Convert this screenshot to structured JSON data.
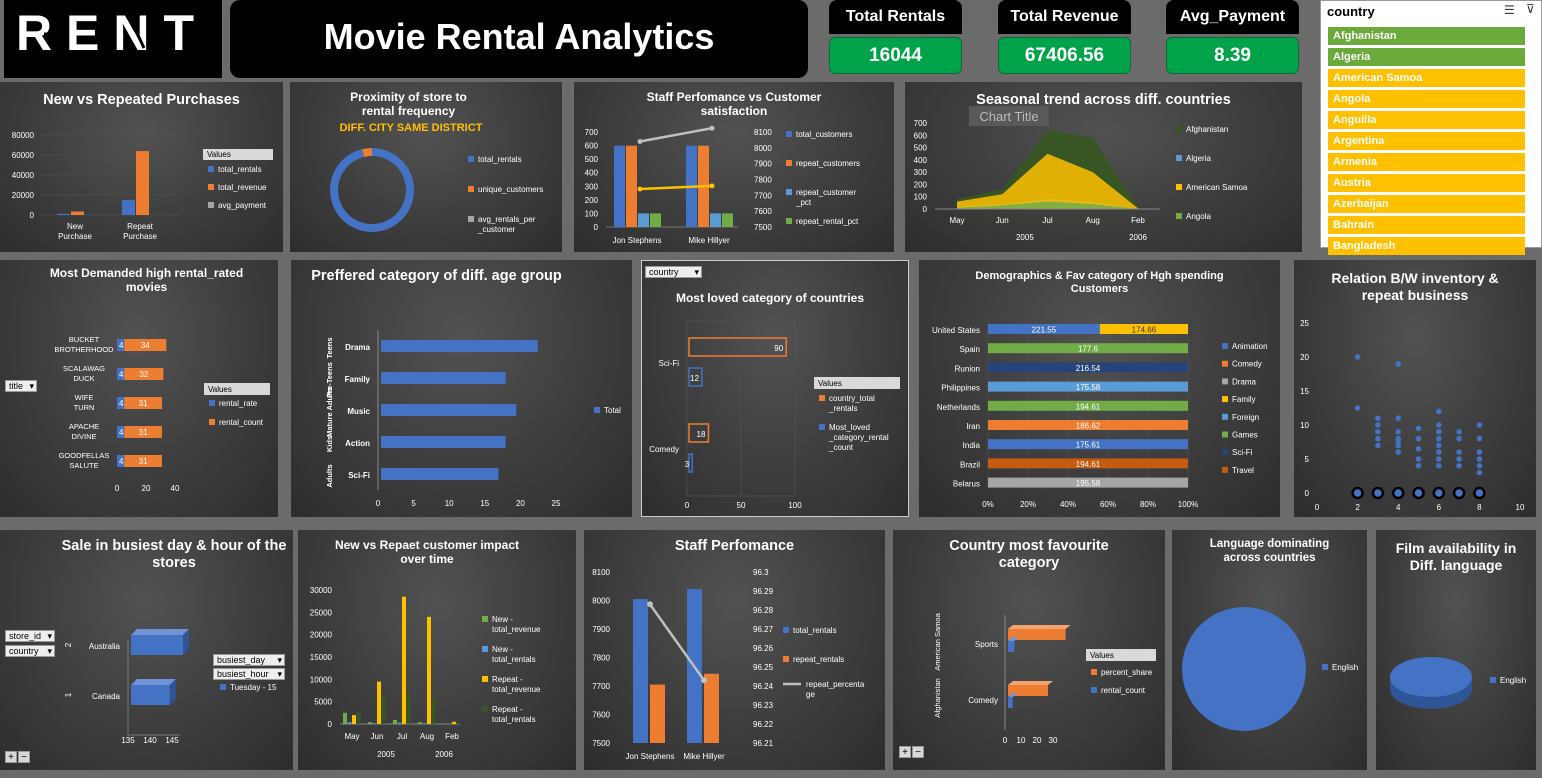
{
  "logo": "RENT",
  "title": "Movie Rental Analytics",
  "kpis": [
    {
      "label": "Total Rentals",
      "value": "16044"
    },
    {
      "label": "Total Revenue",
      "value": "67406.56"
    },
    {
      "label": "Avg_Payment",
      "value": "8.39"
    }
  ],
  "slicer": {
    "title": "country",
    "items": [
      "Afghanistan",
      "Algeria",
      "American Samoa",
      "Angola",
      "Anguilla",
      "Argentina",
      "Armenia",
      "Austria",
      "Azerbaijan",
      "Bahrain",
      "Bangladesh"
    ],
    "selected_color": "#6aaa3a",
    "item_color": "#ffc000"
  },
  "colors": {
    "blue": "#4472c4",
    "orange": "#ed7d31",
    "gray": "#a5a5a5",
    "yellow": "#ffc000",
    "green": "#70ad47",
    "lightblue": "#5b9bd5",
    "navy": "#264478",
    "darkorange": "#c55a11",
    "darkgreen": "#375623",
    "kpi_green": "#00a24a"
  },
  "chart_data": [
    {
      "id": "c1",
      "type": "bar",
      "title": "New vs Repeated Purchases",
      "categories": [
        "New Purchase",
        "Repeat Purchase"
      ],
      "series": [
        {
          "name": "total_rentals",
          "values": [
            1200,
            14844
          ]
        },
        {
          "name": "total_revenue",
          "values": [
            3500,
            63906
          ]
        },
        {
          "name": "avg_payment",
          "values": [
            3,
            8
          ]
        }
      ],
      "ylim": [
        0,
        80000
      ],
      "yticks": [
        0,
        20000,
        40000,
        60000,
        80000
      ],
      "legend_title": "Values"
    },
    {
      "id": "c2",
      "type": "pie",
      "title": "Proximity of store to rental frequency",
      "subtitle": "DIFF. CITY SAME DISTRICT",
      "series": [
        {
          "name": "total_rentals",
          "value": 16044
        },
        {
          "name": "unique_customers",
          "value": 599
        },
        {
          "name": "avg_rentals_per_customer",
          "value": 27
        }
      ]
    },
    {
      "id": "c3",
      "type": "bar",
      "title": "Staff Perfomance vs Customer satisfaction",
      "categories": [
        "Jon Stephens",
        "Mike Hillyer"
      ],
      "series": [
        {
          "name": "total_customers",
          "values": [
            599,
            599
          ]
        },
        {
          "name": "repeat_customers",
          "values": [
            599,
            599
          ]
        },
        {
          "name": "repeat_customer_pct",
          "values": [
            100,
            100
          ]
        },
        {
          "name": "repeat_rental_pct",
          "values": [
            100,
            100
          ]
        }
      ],
      "line_series": [
        {
          "values": [
            8040,
            8124
          ]
        },
        {
          "values": [
            7740,
            7760
          ]
        }
      ],
      "ylim": [
        0,
        700
      ],
      "yticks": [
        0,
        100,
        200,
        300,
        400,
        500,
        600,
        700
      ],
      "y2lim": [
        7500,
        8100
      ],
      "y2ticks": [
        7500,
        7600,
        7700,
        7800,
        7900,
        8000,
        8100
      ]
    },
    {
      "id": "c4",
      "type": "area",
      "title": "Seasonal trend across diff. countries",
      "overlay_label": "Chart Title",
      "categories": [
        "May",
        "Jun",
        "Jul",
        "Aug",
        "Feb"
      ],
      "groups": [
        {
          "label": "2005",
          "span": 4
        },
        {
          "label": "2006",
          "span": 1
        }
      ],
      "series": [
        {
          "name": "Afghanistan",
          "values": [
            80,
            160,
            640,
            580,
            10
          ]
        },
        {
          "name": "Algeria",
          "values": [
            20,
            40,
            80,
            60,
            2
          ]
        },
        {
          "name": "American Samoa",
          "values": [
            60,
            120,
            450,
            300,
            5
          ]
        },
        {
          "name": "Angola",
          "values": [
            10,
            30,
            60,
            40,
            1
          ]
        }
      ],
      "ylim": [
        0,
        700
      ],
      "yticks": [
        0,
        100,
        200,
        300,
        400,
        500,
        600,
        700
      ]
    },
    {
      "id": "c5",
      "type": "bar",
      "orientation": "horizontal",
      "title": "Most Demanded high rental_rated movies",
      "filter_label": "title",
      "categories": [
        "BUCKET BROTHERHOOD",
        "SCALAWAG DUCK",
        "WIFE TURN",
        "APACHE DIVINE",
        "GOODFELLAS SALUTE"
      ],
      "series": [
        {
          "name": "rental_rate",
          "values": [
            4.99,
            4.99,
            4.99,
            4.99,
            4.99
          ]
        },
        {
          "name": "rental_count",
          "values": [
            34,
            32,
            31,
            31,
            31
          ]
        }
      ],
      "xlim": [
        0,
        40
      ],
      "xticks": [
        0,
        20,
        40
      ],
      "legend_title": "Values"
    },
    {
      "id": "c6",
      "type": "bar",
      "orientation": "horizontal",
      "title": "Preffered category of diff. age group",
      "categories": [
        "Drama",
        "Family",
        "Music",
        "Action",
        "Sci-Fi"
      ],
      "groups": [
        "Teens",
        "Pre-Teens",
        "Mature Adults",
        "Kids",
        "Adults"
      ],
      "series": [
        {
          "name": "Total",
          "values": [
            22,
            17.5,
            19,
            17.5,
            16.5
          ]
        }
      ],
      "xlim": [
        0,
        25
      ],
      "xticks": [
        0,
        5,
        10,
        15,
        20,
        25
      ]
    },
    {
      "id": "c7",
      "type": "bar",
      "orientation": "horizontal",
      "title": "Most loved category of countries",
      "filter_label": "country",
      "categories": [
        "Sci-Fi",
        "Comedy"
      ],
      "series": [
        {
          "name": "country_total_rentals",
          "values": [
            90,
            18
          ]
        },
        {
          "name": "Most_loved_category_rental_count",
          "values": [
            12,
            3
          ]
        }
      ],
      "xlim": [
        0,
        100
      ],
      "xticks": [
        0,
        50,
        100
      ],
      "legend_title": "Values"
    },
    {
      "id": "c8",
      "type": "bar",
      "orientation": "horizontal",
      "stacked": "percent",
      "title": "Demographics & Fav category of Hgh spending Customers",
      "categories": [
        "United States",
        "Spain",
        "Runion",
        "Philippines",
        "Netherlands",
        "Iran",
        "India",
        "Brazil",
        "Belarus"
      ],
      "bars": [
        {
          "segments": [
            {
              "series": "Animation",
              "value": 221.55
            },
            {
              "series": "Family",
              "value": 174.66
            }
          ]
        },
        {
          "segments": [
            {
              "series": "Games",
              "value": 177.6
            }
          ]
        },
        {
          "segments": [
            {
              "series": "Sci-Fi",
              "value": 216.54
            }
          ]
        },
        {
          "segments": [
            {
              "series": "Foreign",
              "value": 175.58
            }
          ]
        },
        {
          "segments": [
            {
              "series": "Games",
              "value": 194.61
            }
          ]
        },
        {
          "segments": [
            {
              "series": "Comedy",
              "value": 186.62
            }
          ]
        },
        {
          "segments": [
            {
              "series": "Animation",
              "value": 175.61
            }
          ]
        },
        {
          "segments": [
            {
              "series": "Travel",
              "value": 194.61
            }
          ]
        },
        {
          "segments": [
            {
              "series": "Drama",
              "value": 195.58
            }
          ]
        }
      ],
      "legend": [
        "Animation",
        "Comedy",
        "Drama",
        "Family",
        "Foreign",
        "Games",
        "Sci-Fi",
        "Travel"
      ],
      "xticks": [
        "0%",
        "20%",
        "40%",
        "60%",
        "80%",
        "100%"
      ]
    },
    {
      "id": "c9",
      "type": "scatter",
      "title": "Relation B/W inventory & repeat business",
      "points": [
        [
          2,
          20
        ],
        [
          2,
          12.5
        ],
        [
          2,
          0
        ],
        [
          3,
          11
        ],
        [
          3,
          10
        ],
        [
          3,
          9
        ],
        [
          3,
          8
        ],
        [
          3,
          7
        ],
        [
          3,
          0
        ],
        [
          4,
          19
        ],
        [
          4,
          11
        ],
        [
          4,
          9
        ],
        [
          4,
          8
        ],
        [
          4,
          7.5
        ],
        [
          4,
          7
        ],
        [
          4,
          6
        ],
        [
          4,
          0
        ],
        [
          5,
          9.5
        ],
        [
          5,
          8
        ],
        [
          5,
          6.5
        ],
        [
          5,
          5
        ],
        [
          5,
          4
        ],
        [
          5,
          0
        ],
        [
          6,
          12
        ],
        [
          6,
          10
        ],
        [
          6,
          9
        ],
        [
          6,
          8
        ],
        [
          6,
          7
        ],
        [
          6,
          6
        ],
        [
          6,
          5
        ],
        [
          6,
          4
        ],
        [
          6,
          0
        ],
        [
          7,
          9
        ],
        [
          7,
          8
        ],
        [
          7,
          6
        ],
        [
          7,
          5
        ],
        [
          7,
          4
        ],
        [
          7,
          0
        ],
        [
          8,
          10
        ],
        [
          8,
          8
        ],
        [
          8,
          6
        ],
        [
          8,
          5
        ],
        [
          8,
          4
        ],
        [
          8,
          3
        ],
        [
          8,
          0
        ]
      ],
      "xlim": [
        0,
        10
      ],
      "xticks": [
        0,
        2,
        4,
        6,
        8,
        10
      ],
      "ylim": [
        0,
        25
      ],
      "yticks": [
        0,
        5,
        10,
        15,
        20,
        25
      ]
    },
    {
      "id": "c10",
      "type": "bar",
      "orientation": "horizontal",
      "title": "Sale in busiest day & hour of the stores",
      "filters": [
        "store_id",
        "country",
        "busiest_day",
        "busiest_hour"
      ],
      "categories": [
        "Canada",
        "Australia"
      ],
      "groups": [
        "1",
        "2"
      ],
      "series": [
        {
          "name": "Tuesday - 15",
          "values": [
            142,
            145
          ]
        }
      ],
      "xlim": [
        135,
        145
      ],
      "xticks": [
        135,
        140,
        145
      ]
    },
    {
      "id": "c11",
      "type": "bar",
      "title": "New vs Repaet customer impact over time",
      "categories": [
        "May",
        "Jun",
        "Jul",
        "Aug",
        "Feb"
      ],
      "groups": [
        {
          "label": "2005",
          "span": 4
        },
        {
          "label": "2006",
          "span": 1
        }
      ],
      "series": [
        {
          "name": "New - total_revenue",
          "values": [
            2500,
            400,
            900,
            400,
            100
          ]
        },
        {
          "name": "New - total_rentals",
          "values": [
            400,
            150,
            300,
            150,
            20
          ]
        },
        {
          "name": "Repeat - total_revenue",
          "values": [
            2000,
            9500,
            28500,
            24000,
            500
          ]
        },
        {
          "name": "Repeat - total_rentals",
          "values": [
            2800,
            6500,
            7000,
            5700,
            200
          ]
        }
      ],
      "ylim": [
        0,
        30000
      ],
      "yticks": [
        0,
        5000,
        10000,
        15000,
        20000,
        25000,
        30000
      ]
    },
    {
      "id": "c12",
      "type": "bar",
      "title": "Staff Perfomance",
      "categories": [
        "Jon Stephens",
        "Mike Hillyer"
      ],
      "series": [
        {
          "name": "total_rentals",
          "values": [
            8005,
            8040
          ]
        },
        {
          "name": "repeat_rentals",
          "values": [
            7705,
            7743
          ]
        }
      ],
      "line_series": [
        {
          "name": "repeat_percentage",
          "values": [
            96.283,
            96.243
          ]
        }
      ],
      "ylim": [
        7500,
        8100
      ],
      "yticks": [
        7500,
        7600,
        7700,
        7800,
        7900,
        8000,
        8100
      ],
      "y2lim": [
        96.21,
        96.3
      ],
      "y2ticks": [
        96.21,
        96.22,
        96.23,
        96.24,
        96.25,
        96.26,
        96.27,
        96.28,
        96.29,
        96.3
      ]
    },
    {
      "id": "c13",
      "type": "bar",
      "orientation": "horizontal",
      "title": "Country most favourite category",
      "categories": [
        "Comedy",
        "Sports"
      ],
      "groups": [
        "Afghanistan",
        "American Samoa"
      ],
      "series": [
        {
          "name": "percent_share",
          "values": [
            25,
            36
          ]
        },
        {
          "name": "rental_count",
          "values": [
            3,
            4
          ]
        }
      ],
      "xlim": [
        0,
        30
      ],
      "xticks": [
        0,
        10,
        20,
        30
      ],
      "legend_title": "Values"
    },
    {
      "id": "c14",
      "type": "pie",
      "title": "Language dominating across countries",
      "series": [
        {
          "name": "English",
          "value": 100
        }
      ]
    },
    {
      "id": "c15",
      "type": "pie",
      "title": "Film availability in Diff. language",
      "series": [
        {
          "name": "English",
          "value": 100
        }
      ]
    }
  ]
}
